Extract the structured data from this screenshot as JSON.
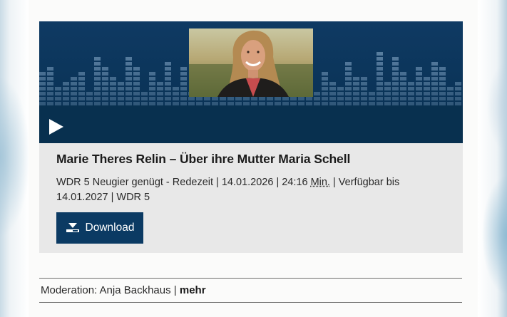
{
  "player": {
    "title": "Marie Theres Relin – Über ihre Mutter Maria Schell",
    "meta_show": "WDR 5 Neugier genügt - Redezeit | 14.01.2026 | 24:16 ",
    "meta_unit": "Min.",
    "meta_rest": " | Verfügbar bis 14.01.2027 | WDR 5",
    "download_label": "Download",
    "play_icon": "play-icon",
    "download_icon": "download-icon"
  },
  "moderation": {
    "label": "Moderation: Anja Backhaus | ",
    "more": "mehr"
  },
  "colors": {
    "banner": "#0b3a63",
    "button": "#0b3a63",
    "panel": "#e8e8e8"
  }
}
